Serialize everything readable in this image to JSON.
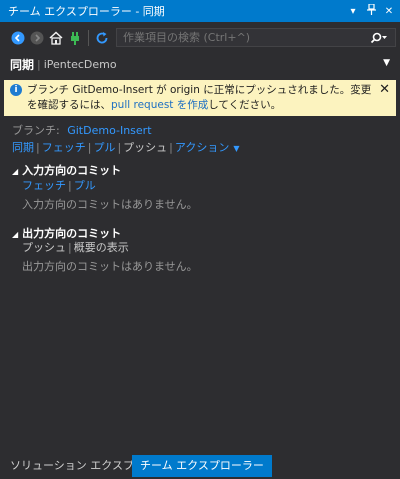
{
  "window": {
    "title": "チーム エクスプローラー - 同期"
  },
  "titlebar_icons": [
    "dropdown-icon",
    "pin-icon",
    "close-icon"
  ],
  "toolbar": {
    "buttons": [
      "back-icon",
      "forward-icon",
      "home-icon",
      "connect-icon",
      "refresh-icon"
    ],
    "search_placeholder": "作業項目の検索 (Ctrl+^)"
  },
  "header": {
    "title": "同期",
    "repo": "iPentecDemo"
  },
  "info": {
    "text_part1": "ブランチ GitDemo-Insert が origin に正常にプッシュされました。変更を確認するには、",
    "link": "pull request を作成",
    "text_part2": "してください。"
  },
  "branch": {
    "label": "ブランチ:",
    "name": "GitDemo-Insert"
  },
  "actions": {
    "sync": "同期",
    "fetch": "フェッチ",
    "pull": "プル",
    "push": "プッシュ",
    "action": "アクション"
  },
  "incoming": {
    "title": "入力方向のコミット",
    "fetch": "フェッチ",
    "pull": "プル",
    "empty": "入力方向のコミットはありません。"
  },
  "outgoing": {
    "title": "出力方向のコミット",
    "push": "プッシュ",
    "summary": "概要の表示",
    "empty": "出力方向のコミットはありません。"
  },
  "tabs": [
    "ソリューション エクスプローラー",
    "チーム エクスプローラー"
  ],
  "colors": {
    "accent": "#007acc",
    "background": "#2d2d30",
    "link": "#3399ff",
    "info_bg": "#fcf3bf"
  }
}
